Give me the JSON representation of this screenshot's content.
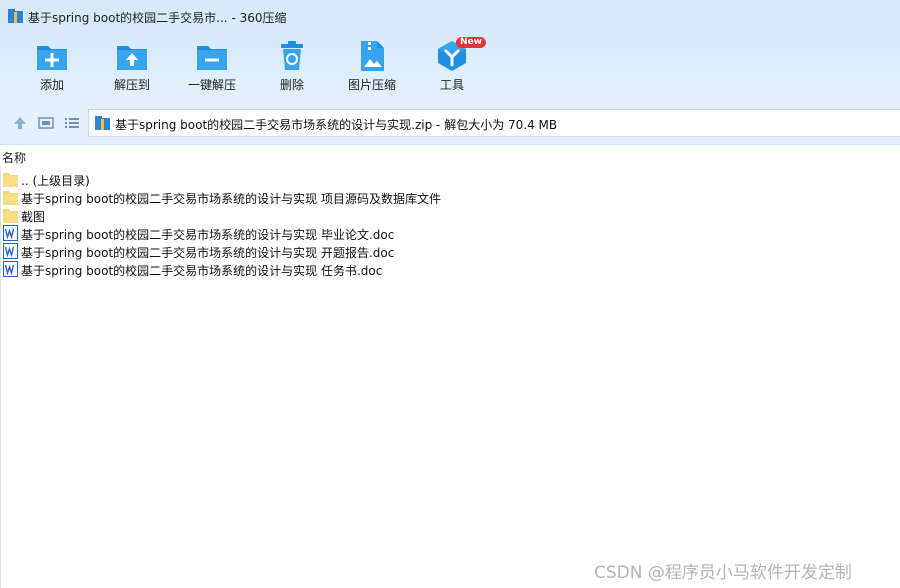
{
  "window": {
    "title": "基于spring boot的校园二手交易市... - 360压缩"
  },
  "toolbar": {
    "items": [
      {
        "label": "添加",
        "icon": "add-icon"
      },
      {
        "label": "解压到",
        "icon": "extract-to-icon"
      },
      {
        "label": "一键解压",
        "icon": "one-click-extract-icon"
      },
      {
        "label": "删除",
        "icon": "delete-icon"
      },
      {
        "label": "图片压缩",
        "icon": "image-compress-icon"
      },
      {
        "label": "工具",
        "icon": "tools-icon"
      }
    ],
    "badge": "New"
  },
  "address": {
    "text": "基于spring boot的校园二手交易市场系统的设计与实现.zip - 解包大小为 70.4 MB"
  },
  "list": {
    "column_name": "名称",
    "items": [
      {
        "name": ".. (上级目录)",
        "icon": "folder-icon"
      },
      {
        "name": "基于spring boot的校园二手交易市场系统的设计与实现 项目源码及数据库文件",
        "icon": "folder-icon"
      },
      {
        "name": "截图",
        "icon": "folder-icon"
      },
      {
        "name": "基于spring boot的校园二手交易市场系统的设计与实现 毕业论文.doc",
        "icon": "word-doc-icon"
      },
      {
        "name": "基于spring boot的校园二手交易市场系统的设计与实现 开题报告.doc",
        "icon": "word-doc-icon"
      },
      {
        "name": "基于spring boot的校园二手交易市场系统的设计与实现 任务书.doc",
        "icon": "word-doc-icon"
      }
    ]
  },
  "watermark": "CSDN @程序员小马软件开发定制",
  "colors": {
    "toolbar_bg": "#d7eaf9",
    "icon_blue": "#1e8fe0",
    "badge_red": "#e8323c",
    "folder_yellow": "#f7d774",
    "word_blue": "#2b5fcf"
  }
}
